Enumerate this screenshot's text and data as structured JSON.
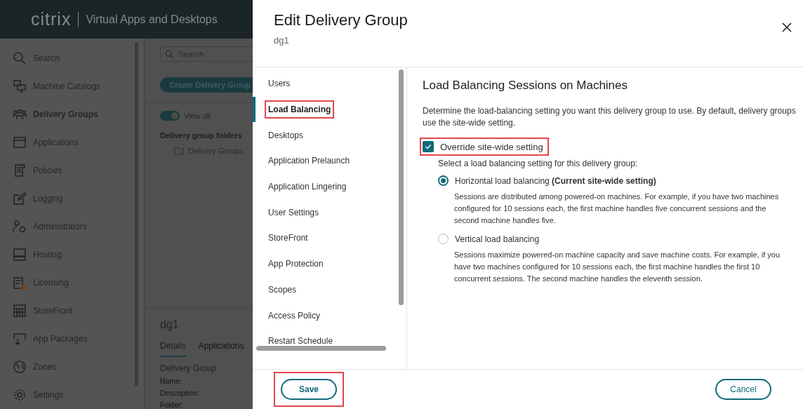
{
  "app": {
    "brand": "citrix",
    "product": "Virtual Apps and Desktops",
    "nav": [
      {
        "label": "Search"
      },
      {
        "label": "Machine Catalogs"
      },
      {
        "label": "Delivery Groups",
        "selected": true
      },
      {
        "label": "Applications"
      },
      {
        "label": "Policies"
      },
      {
        "label": "Logging"
      },
      {
        "label": "Administrators"
      },
      {
        "label": "Hosting"
      },
      {
        "label": "Licensing"
      },
      {
        "label": "StoreFront"
      },
      {
        "label": "App Packages"
      },
      {
        "label": "Zones"
      },
      {
        "label": "Settings"
      }
    ],
    "search": {
      "placeholder": "Search"
    },
    "create_button": "Create Delivery Group",
    "view_all": {
      "label": "View all",
      "on": true
    },
    "folders_heading": "Delivery group folders",
    "folder": "Delivery Groups",
    "detail": {
      "title": "dg1",
      "tabs": [
        {
          "label": "Details",
          "selected": true
        },
        {
          "label": "Applications",
          "selected": false
        }
      ],
      "section": "Delivery Group",
      "fields": [
        "Name:",
        "Description:",
        "Folder:"
      ]
    }
  },
  "dialog": {
    "title": "Edit Delivery Group",
    "subtitle": "dg1",
    "steps": [
      {
        "label": "Users",
        "selected": false,
        "highlighted": false
      },
      {
        "label": "Load Balancing",
        "selected": true,
        "highlighted": true
      },
      {
        "label": "Desktops",
        "selected": false,
        "highlighted": false
      },
      {
        "label": "Application Prelaunch",
        "selected": false,
        "highlighted": false
      },
      {
        "label": "Application Lingering",
        "selected": false,
        "highlighted": false
      },
      {
        "label": "User Settings",
        "selected": false,
        "highlighted": false
      },
      {
        "label": "StoreFront",
        "selected": false,
        "highlighted": false
      },
      {
        "label": "App Protection",
        "selected": false,
        "highlighted": false
      },
      {
        "label": "Scopes",
        "selected": false,
        "highlighted": false
      },
      {
        "label": "Access Policy",
        "selected": false,
        "highlighted": false
      },
      {
        "label": "Restart Schedule",
        "selected": false,
        "highlighted": false
      }
    ],
    "heading": "Load Balancing Sessions on Machines",
    "intro": "Determine the load-balancing setting you want this delivery group to use. By default, delivery groups use the site-wide setting.",
    "override": {
      "label": "Override site-wide setting",
      "checked": true,
      "highlighted": true
    },
    "prompt": "Select a load balancing setting for this delivery group:",
    "options": [
      {
        "label": "Horizontal load balancing **(Current site-wide setting)**",
        "selected": true,
        "description": "Sessions are distributed among powered-on machines. For example, if you have two machines configured for 10 sessions each, the first machine handles five concurrent sessions and the second machine handles five."
      },
      {
        "label": "Vertical load balancing",
        "selected": false,
        "description": "Sessions maximize powered-on machine capacity and save machine costs. For example, if you have two machines configured for 10 sessions each, the first machine handles the first 10 concurrent sessions. The second machine handles the eleventh session."
      }
    ],
    "buttons": [
      {
        "label": "Save",
        "kind": "save",
        "highlighted": true
      },
      {
        "label": "Cancel",
        "kind": "cancel",
        "highlighted": false
      }
    ]
  }
}
